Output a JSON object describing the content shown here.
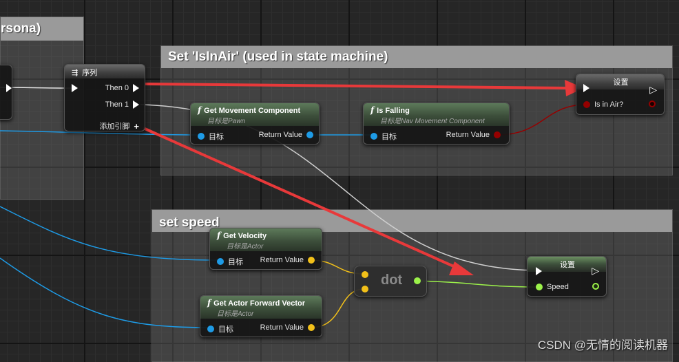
{
  "comments": {
    "left_partial": "rsona)",
    "isinair": "Set 'IsInAir' (used in state machine)",
    "setspeed": "set speed"
  },
  "sequence": {
    "title": "序列",
    "then0": "Then 0",
    "then1": "Then 1",
    "add_pin": "添加引脚"
  },
  "get_movement": {
    "title": "Get Movement Component",
    "subtitle": "目标是Pawn",
    "target": "目标",
    "ret": "Return Value"
  },
  "is_falling": {
    "title": "Is Falling",
    "subtitle": "目标是Nav Movement Component",
    "target": "目标",
    "ret": "Return Value"
  },
  "set_inair": {
    "title": "设置",
    "pin": "Is in Air?"
  },
  "get_velocity": {
    "title": "Get Velocity",
    "subtitle": "目标是Actor",
    "target": "目标",
    "ret": "Return Value"
  },
  "get_forward": {
    "title": "Get Actor Forward Vector",
    "subtitle": "目标是Actor",
    "target": "目标",
    "ret": "Return Value"
  },
  "dot_node": {
    "title": "dot"
  },
  "set_speed": {
    "title": "设置",
    "pin": "Speed"
  },
  "watermark": "CSDN @无情的阅读机器",
  "colors": {
    "exec": "#ffffff",
    "object": "#1e9be6",
    "bool": "#950000",
    "vector": "#f2c019",
    "float": "#9cf24a",
    "annotation_arrow": "#e8393a"
  }
}
